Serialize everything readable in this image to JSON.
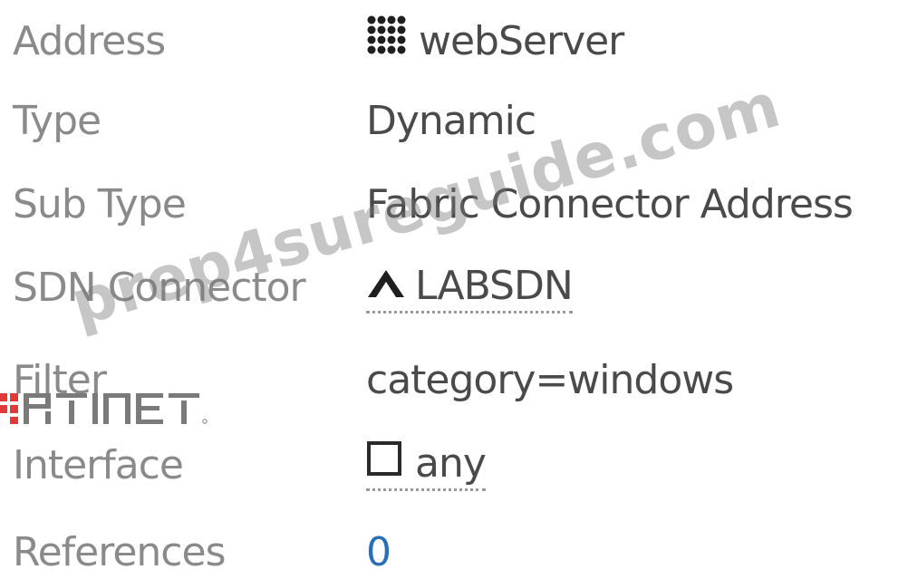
{
  "fields": [
    {
      "label": "Address",
      "value": "webServer",
      "icon": "address-grid-icon"
    },
    {
      "label": "Type",
      "value": "Dynamic"
    },
    {
      "label": "Sub Type",
      "value": "Fabric Connector Address"
    },
    {
      "label": "SDN Connector",
      "value": "LABSDN",
      "icon": "sdn-connector-icon"
    },
    {
      "label": "Filter",
      "value": "category=windows"
    },
    {
      "label": "Interface",
      "value": "any",
      "icon": "interface-square-icon"
    },
    {
      "label": "References",
      "value": "0"
    }
  ],
  "watermark": "prep4sureguide.com",
  "logo": "FORTINET",
  "colors": {
    "label": "#8a8a8a",
    "value": "#4a4a4a",
    "link": "#2a6fb6",
    "logo_red": "#e03a3a",
    "logo_gray": "#7a7a7a"
  }
}
